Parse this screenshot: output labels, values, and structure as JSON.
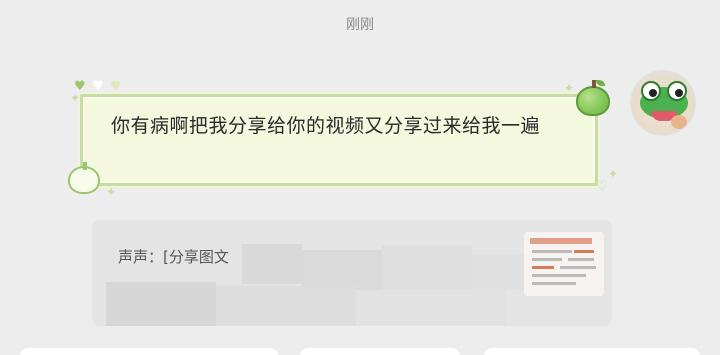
{
  "timestamp": "刚刚",
  "message": {
    "text": "你有病啊把我分享给你的视频又分享过来给我一遍"
  },
  "quote": {
    "sender_prefix": "声声：",
    "preview": "[分享图文"
  },
  "colors": {
    "background": "#ededed",
    "bubble_fill": "#f3f8df",
    "bubble_border": "#c9dca4",
    "quote_card": "#e4e4e4",
    "apple_green": "#86c95a"
  },
  "icons": {
    "avatar": "frog-avatar-icon",
    "apple": "apple-icon",
    "heart": "heart-icon",
    "sparkle": "sparkle-icon"
  }
}
